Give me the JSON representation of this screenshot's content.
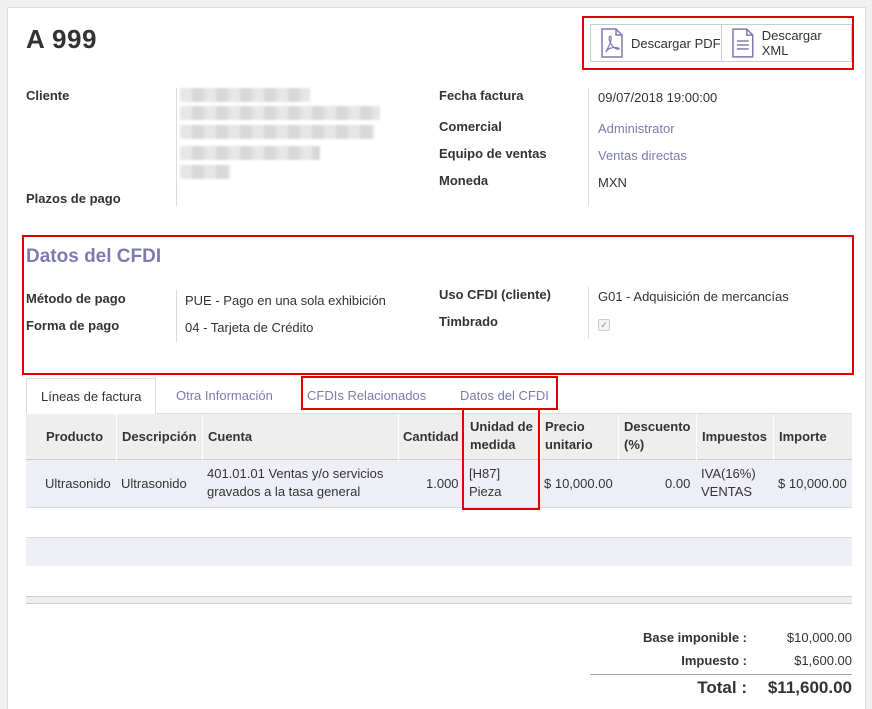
{
  "invoice": {
    "title": "A 999"
  },
  "downloads": {
    "pdf_label": "Descargar PDF",
    "xml_label": "Descargar XML"
  },
  "header_left": {
    "cliente_label": "Cliente",
    "plazos_label": "Plazos de pago"
  },
  "header_right": {
    "fecha_label": "Fecha factura",
    "fecha_value": "09/07/2018 19:00:00",
    "comercial_label": "Comercial",
    "comercial_value": "Administrator",
    "equipo_label": "Equipo de ventas",
    "equipo_value": "Ventas directas",
    "moneda_label": "Moneda",
    "moneda_value": "MXN"
  },
  "cfdi": {
    "title": "Datos del CFDI",
    "metodo_label": "Método de pago",
    "metodo_value": "PUE - Pago en una sola exhibición",
    "forma_label": "Forma de pago",
    "forma_value": "04 - Tarjeta de Crédito",
    "uso_label": "Uso CFDI (cliente)",
    "uso_value": "G01 - Adquisición de mercancías",
    "timbrado_label": "Timbrado",
    "timbrado_checked": true
  },
  "tabs": [
    "Líneas de factura",
    "Otra Información",
    "CFDIs Relacionados",
    "Datos del CFDI"
  ],
  "table": {
    "headers": [
      "Producto",
      "Descripción",
      "Cuenta",
      "Cantidad",
      "Unidad de",
      "medida",
      "Precio",
      "unitario",
      "Descuento",
      "(%)",
      "Impuestos",
      "Importe"
    ],
    "row": {
      "producto": "Ultrasonido",
      "descripcion": "Ultrasonido",
      "cuenta_1": "401.01.01 Ventas y/o servicios",
      "cuenta_2": "gravados a la tasa general",
      "cantidad": "1.000",
      "unidad_1": "[H87]",
      "unidad_2": "Pieza",
      "precio": "$ 10,000.00",
      "descuento": "0.00",
      "impuestos_1": "IVA(16%)",
      "impuestos_2": "VENTAS",
      "importe": "$ 10,000.00"
    }
  },
  "totals": {
    "base_label": "Base imponible :",
    "base_value": "$10,000.00",
    "impuesto_label": "Impuesto :",
    "impuesto_value": "$1,600.00",
    "total_label": "Total :",
    "total_value": "$11,600.00"
  },
  "colors": {
    "accent": "#7c7bad",
    "highlight": "#e00000"
  }
}
